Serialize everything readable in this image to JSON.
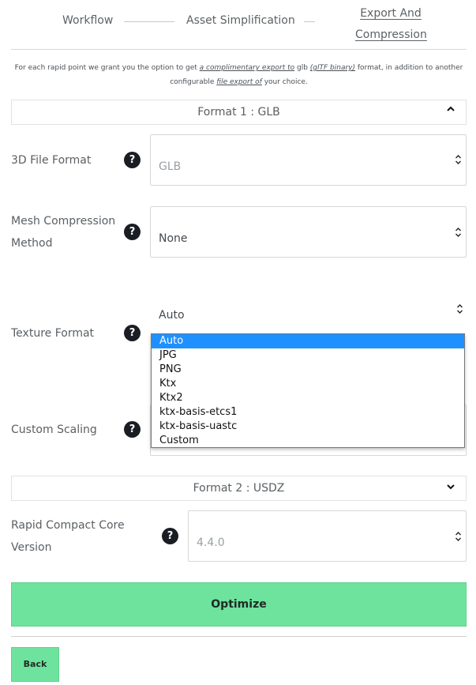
{
  "stepper": {
    "steps": [
      "Workflow",
      "Asset Simplification",
      "Export And Compression"
    ]
  },
  "intro": {
    "part1": "For each rapid point we grant you the option to get ",
    "link1": "a complimentary export to",
    "part2": " glb ",
    "link2": "(glTF binary)",
    "part3": " format, in addition to another configurable ",
    "link3": "file export of",
    "part4": " your choice."
  },
  "format1": {
    "title": "Format 1 : GLB",
    "file_format_label": "3D File Format",
    "file_format_value": "GLB",
    "mesh_label_line1": "Mesh Compression",
    "mesh_label_line2": "Method",
    "mesh_value": "None",
    "texture_label": "Texture Format",
    "texture_value": "Auto",
    "texture_options": [
      "Auto",
      "JPG",
      "PNG",
      "Ktx",
      "Ktx2",
      "ktx-basis-etcs1",
      "ktx-basis-uastc",
      "Custom"
    ],
    "scaling_label": "Custom Scaling"
  },
  "format2": {
    "title": "Format 2 : USDZ",
    "core_label_line1": "Rapid Compact Core",
    "core_label_line2": "Version",
    "core_value": "4.4.0"
  },
  "help_glyph": "?",
  "buttons": {
    "optimize": "Optimize",
    "back": "Back"
  },
  "icons": {
    "chevron_up": "chevron-up-icon",
    "chevron_down": "chevron-down-icon",
    "select_arrows": "updown-arrows-icon",
    "help": "help-icon"
  },
  "colors": {
    "accent_green": "#6ee39d",
    "selected_option": "#1e90ff",
    "help_bg": "#1a1d23"
  }
}
